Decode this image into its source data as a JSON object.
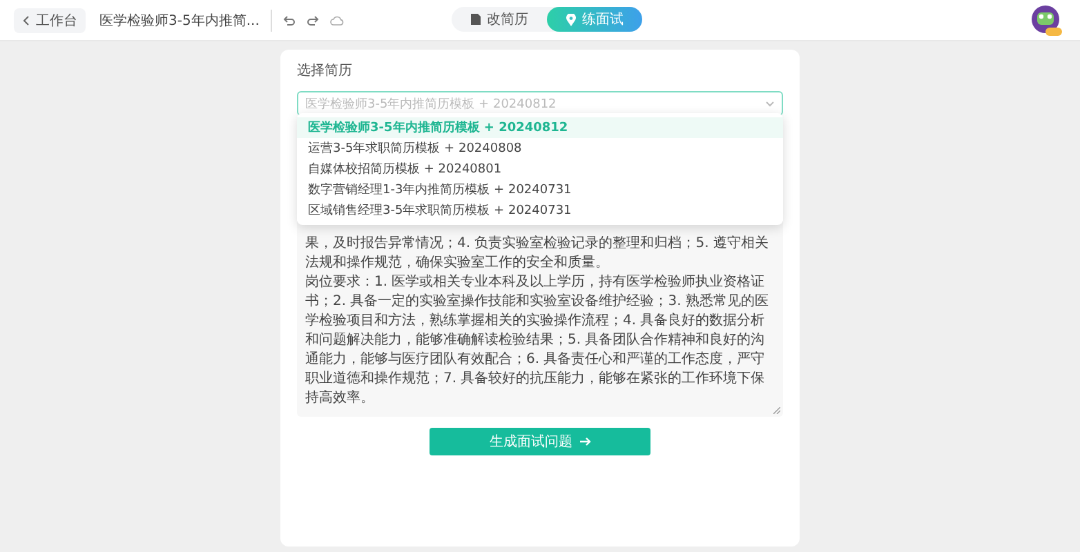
{
  "topbar": {
    "back_label": "工作台",
    "document_title": "医学检验师3-5年内推简...",
    "tabs": [
      {
        "label": "改简历",
        "selected": false
      },
      {
        "label": "练面试",
        "selected": true
      }
    ]
  },
  "form": {
    "label": "选择简历",
    "select_value": "医学检验师3-5年内推简历模板 + 20240812",
    "options": [
      {
        "label": "医学检验师3-5年内推简历模板 + 20240812",
        "selected": true
      },
      {
        "label": "运营3-5年求职简历模板 + 20240808",
        "selected": false
      },
      {
        "label": "自媒体校招简历模板 + 20240801",
        "selected": false
      },
      {
        "label": "数字营销经理1-3年内推简历模板 + 20240731",
        "selected": false
      },
      {
        "label": "区域销售经理3-5年求职简历模板 + 20240731",
        "selected": false
      }
    ],
    "job_description": [
      "果，及时报告异常情况；4. 负责实验室检验记录的整理和归档；5. 遵守相关法规和操作规范，确保实验室工作的安全和质量。",
      "岗位要求：1. 医学或相关专业本科及以上学历，持有医学检验师执业资格证书；2. 具备一定的实验室操作技能和实验室设备维护经验；3. 熟悉常见的医学检验项目和方法，熟练掌握相关的实验操作流程；4. 具备良好的数据分析和问题解决能力，能够准确解读检验结果；5. 具备团队合作精神和良好的沟通能力，能够与医疗团队有效配合；6. 具备责任心和严谨的工作态度，严守职业道德和操作规范；7. 具备较好的抗压能力，能够在紧张的工作环境下保持高效率。"
    ],
    "submit_label": "生成面试问题"
  }
}
